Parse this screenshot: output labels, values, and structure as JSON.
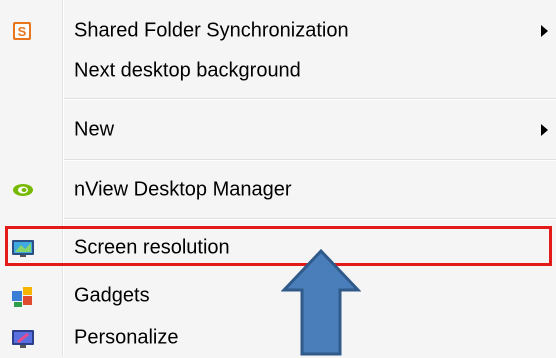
{
  "menu": {
    "items": [
      {
        "label": "Shared Folder Synchronization",
        "icon": "shared-folder-sync-icon",
        "submenu": true
      },
      {
        "label": "Next desktop background",
        "icon": "",
        "submenu": false
      },
      {
        "label": "New",
        "icon": "",
        "submenu": true
      },
      {
        "label": "nView Desktop Manager",
        "icon": "nvidia-icon",
        "submenu": false
      },
      {
        "label": "Screen resolution",
        "icon": "screen-resolution-icon",
        "submenu": false
      },
      {
        "label": "Gadgets",
        "icon": "gadgets-icon",
        "submenu": false
      },
      {
        "label": "Personalize",
        "icon": "personalize-icon",
        "submenu": false
      }
    ]
  },
  "annotation": {
    "highlight_color": "#e21a1a",
    "arrow_color": "#4a7ebb",
    "arrow_border_color": "#2f5a8a"
  }
}
